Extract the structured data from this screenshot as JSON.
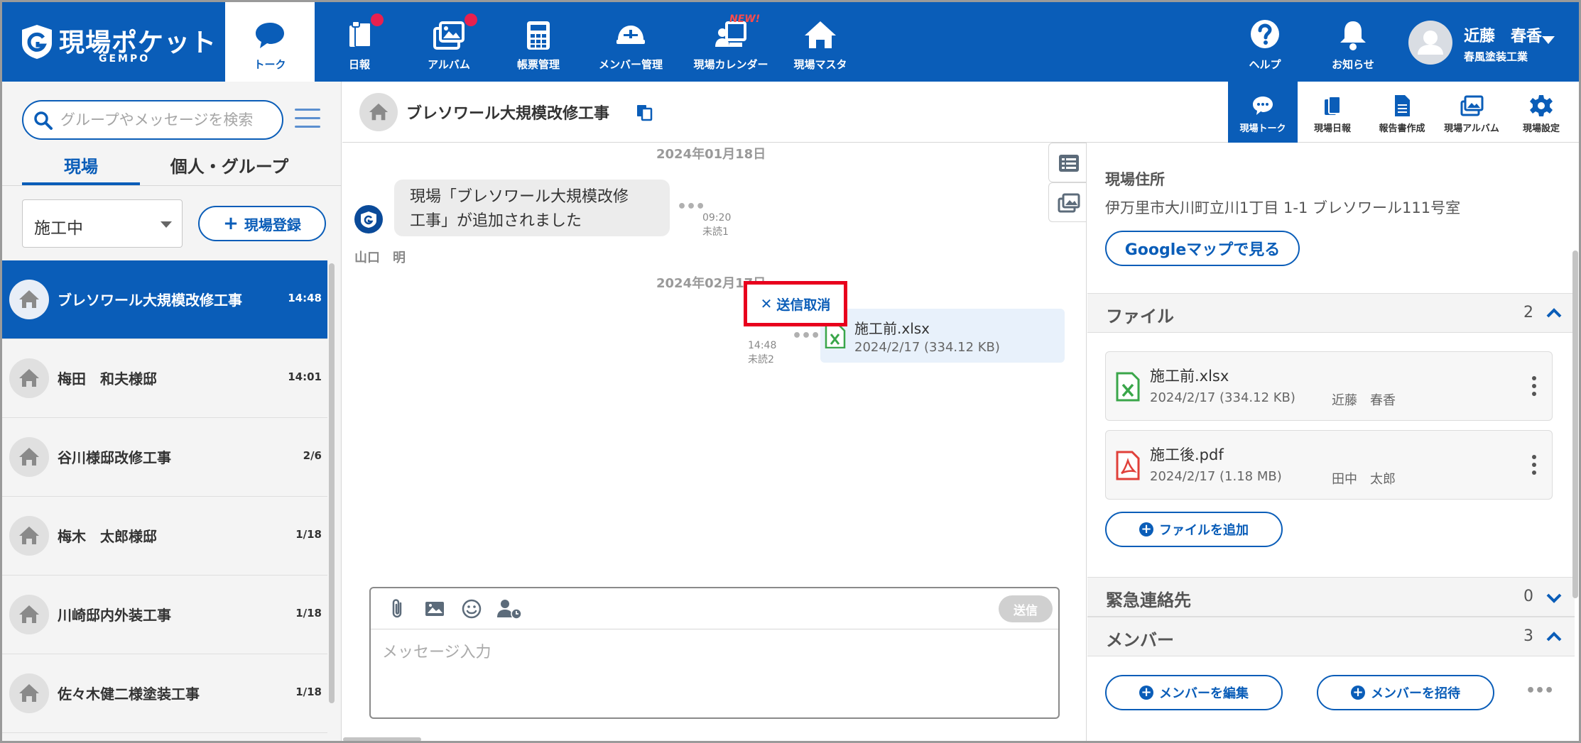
{
  "brand": {
    "name": "現場ポケット",
    "sub": "GEMPO"
  },
  "nav": {
    "items": [
      {
        "label": "トーク",
        "icon": "chat-icon"
      },
      {
        "label": "日報",
        "icon": "report-icon"
      },
      {
        "label": "アルバム",
        "icon": "album-icon"
      },
      {
        "label": "帳票管理",
        "icon": "calculator-icon"
      },
      {
        "label": "メンバー管理",
        "icon": "helmet-icon"
      },
      {
        "label": "現場カレンダー",
        "icon": "calendar-icon"
      },
      {
        "label": "現場マスタ",
        "icon": "house-icon"
      }
    ],
    "new_badge": "NEW!",
    "help_label": "ヘルプ",
    "notify_label": "お知らせ"
  },
  "user": {
    "name": "近藤　春香",
    "company": "春風塗装工業"
  },
  "left": {
    "search_placeholder": "グループやメッセージを検索",
    "tabs": [
      "現場",
      "個人・グループ"
    ],
    "status_value": "施工中",
    "register_label": "現場登録",
    "sites": [
      {
        "name": "ブレソワール大規模改修工事",
        "time": "14:48"
      },
      {
        "name": "梅田　和夫様邸",
        "time": "14:01"
      },
      {
        "name": "谷川様邸改修工事",
        "time": "2/6"
      },
      {
        "name": "梅木　太郎様邸",
        "time": "1/18"
      },
      {
        "name": "川崎邸内外装工事",
        "time": "1/18"
      },
      {
        "name": "佐々木健二様塗装工事",
        "time": "1/18"
      }
    ]
  },
  "chat": {
    "title": "ブレソワール大規模改修工事",
    "date1": "2024年01月18日",
    "system_message_line1": "現場「ブレソワール大規模改修",
    "system_message_line2": "工事」が追加されました",
    "msg1_time": "09:20",
    "msg1_unread": "未読1",
    "sender": "山口　明",
    "date2": "2024年02月17日",
    "file_name": "施工前.xlsx",
    "file_sub": "2024/2/17 (334.12 KB)",
    "msg2_time": "14:48",
    "msg2_unread": "未読2",
    "cancel_label": "送信取消",
    "input_placeholder": "メッセージ入力",
    "send_label": "送信"
  },
  "right": {
    "tabs": [
      {
        "label": "現場トーク",
        "icon": "chat-icon"
      },
      {
        "label": "現場日報",
        "icon": "report-icon"
      },
      {
        "label": "報告書作成",
        "icon": "document-icon"
      },
      {
        "label": "現場アルバム",
        "icon": "album-icon"
      },
      {
        "label": "現場設定",
        "icon": "gear-icon"
      }
    ],
    "address_label": "現場住所",
    "address": "伊万里市大川町立川1丁目 1-1 ブレソワール111号室",
    "map_button": "Googleマップで見る",
    "files_title": "ファイル",
    "files_count": "2",
    "files": [
      {
        "name": "施工前.xlsx",
        "meta": "2024/2/17 (334.12 KB)",
        "user": "近藤　春香",
        "type": "xlsx"
      },
      {
        "name": "施工後.pdf",
        "meta": "2024/2/17 (1.18 MB)",
        "user": "田中　太郎",
        "type": "pdf"
      }
    ],
    "add_file_label": "ファイルを追加",
    "emergency_title": "緊急連絡先",
    "emergency_count": "0",
    "members_title": "メンバー",
    "members_count": "3",
    "edit_members_label": "メンバーを編集",
    "invite_members_label": "メンバーを招待"
  },
  "colors": {
    "brand_blue": "#0a5db8",
    "highlight_red": "#e8001d",
    "badge_red": "#e8204f",
    "excel_green": "#3aa64a",
    "pdf_red": "#e0403a"
  }
}
